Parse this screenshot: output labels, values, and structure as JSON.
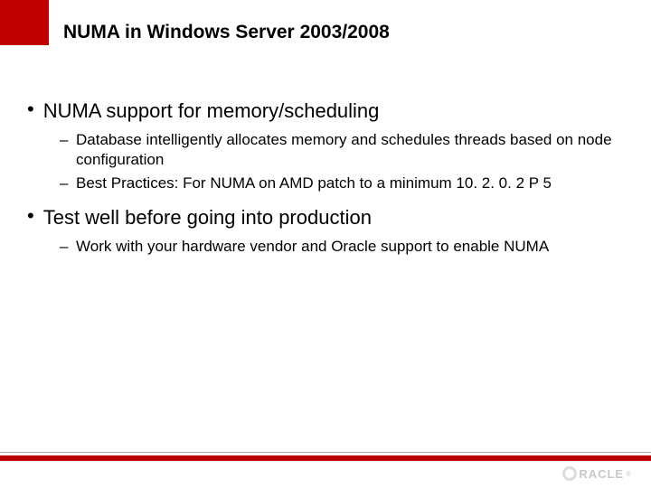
{
  "title": "NUMA in Windows Server 2003/2008",
  "bullets": [
    {
      "text": "NUMA support for memory/scheduling",
      "sub": [
        "Database intelligently allocates memory and schedules threads based on node configuration",
        "Best Practices: For NUMA on AMD patch to a minimum 10. 2. 0. 2 P 5"
      ]
    },
    {
      "text": "Test well before going into production",
      "sub": [
        "Work with your hardware vendor and Oracle support to enable NUMA"
      ]
    }
  ],
  "logo": {
    "text": "RACLE",
    "reg": "®"
  },
  "accent_color": "#c00000"
}
